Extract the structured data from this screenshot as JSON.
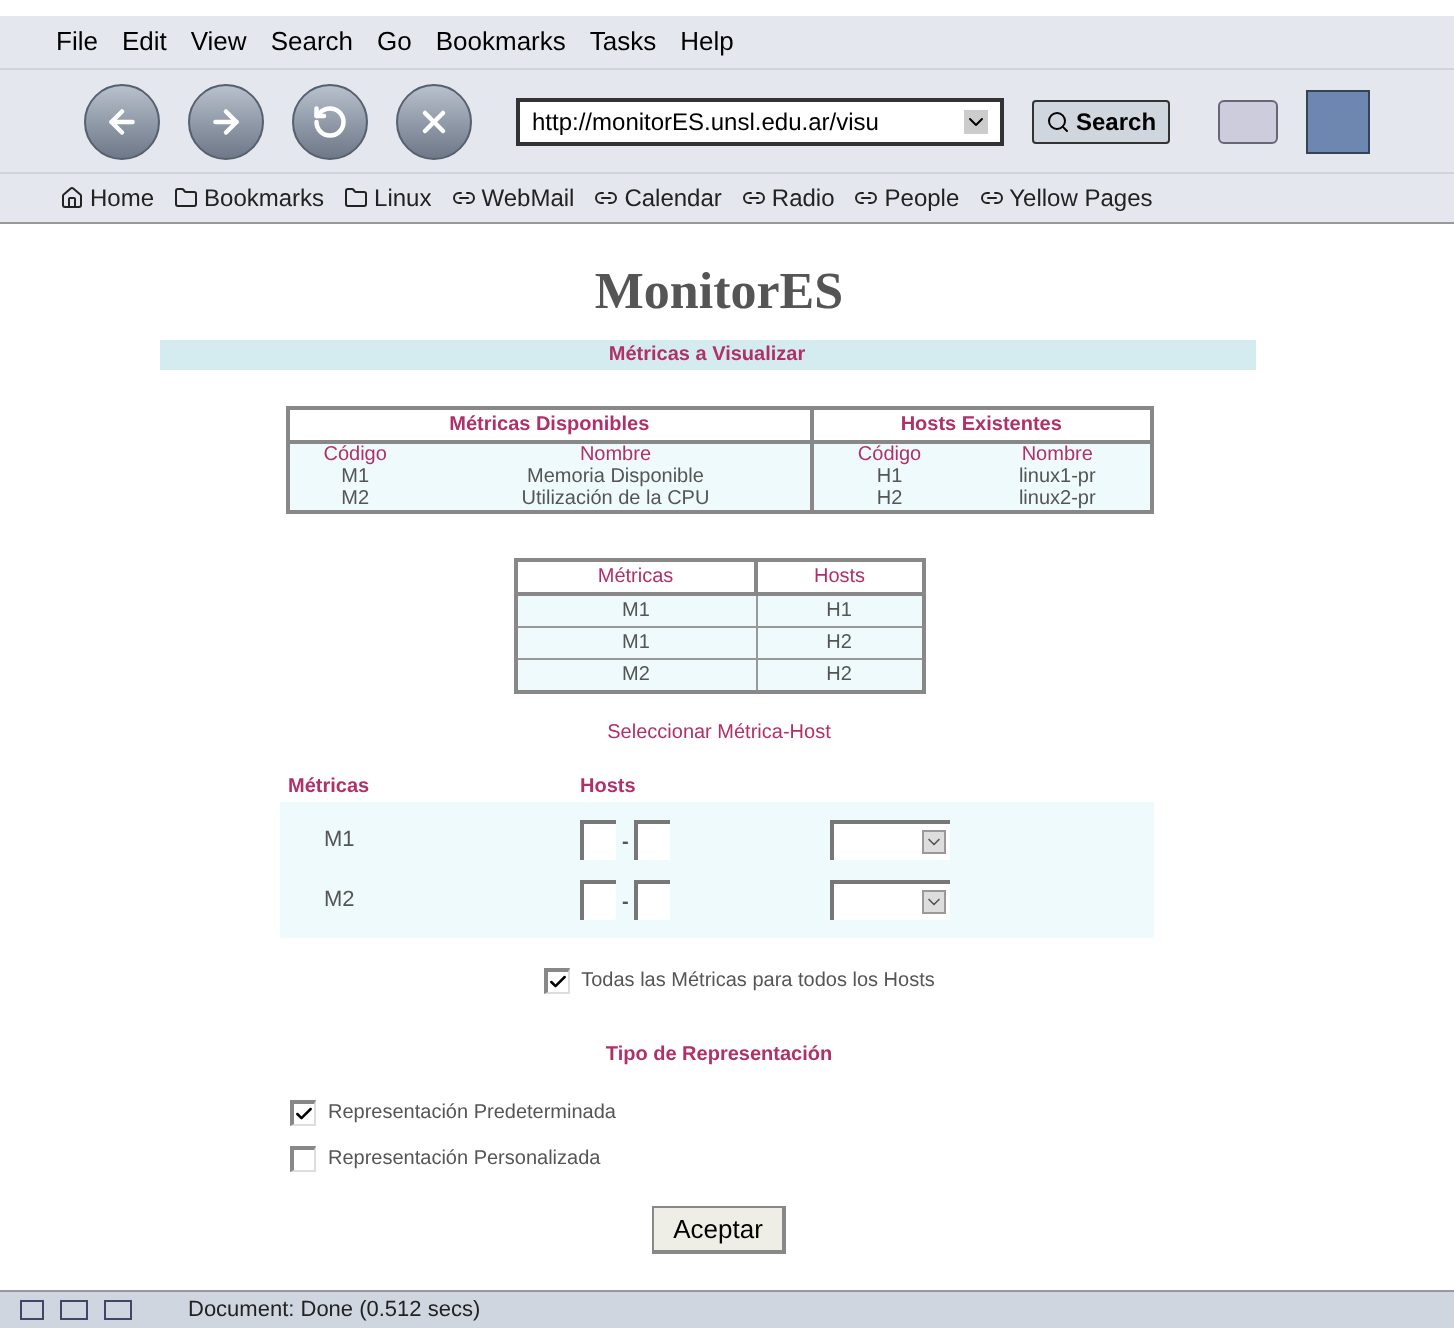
{
  "menu": [
    "File",
    "Edit",
    "View",
    "Search",
    "Go",
    "Bookmarks",
    "Tasks",
    "Help"
  ],
  "url_field": {
    "value": "http://monitorES.unsl.edu.ar/visu"
  },
  "search_button": "Search",
  "bookmarks": [
    {
      "label": "Home",
      "kind": "home"
    },
    {
      "label": "Bookmarks",
      "kind": "folder"
    },
    {
      "label": "Linux",
      "kind": "folder"
    },
    {
      "label": "WebMail",
      "kind": "link"
    },
    {
      "label": "Calendar",
      "kind": "link"
    },
    {
      "label": "Radio",
      "kind": "link"
    },
    {
      "label": "People",
      "kind": "link"
    },
    {
      "label": "Yellow Pages",
      "kind": "link"
    }
  ],
  "page": {
    "title": "MonitorES",
    "section_title": "Métricas a Visualizar",
    "available": {
      "metrics_heading": "Métricas Disponibles",
      "hosts_heading": "Hosts Existentes",
      "metric_columns": [
        "Código",
        "Nombre"
      ],
      "host_columns": [
        "Código",
        "Nombre"
      ],
      "metrics": [
        [
          "M1",
          "Memoria Disponible"
        ],
        [
          "M2",
          "Utilización de la CPU"
        ]
      ],
      "hosts": [
        [
          "H1",
          "linux1-pr"
        ],
        [
          "H2",
          "linux2-pr"
        ]
      ]
    },
    "pairs": {
      "columns": [
        "Métricas",
        "Hosts"
      ],
      "rows": [
        [
          "M1",
          "H1"
        ],
        [
          "M1",
          "H2"
        ],
        [
          "M2",
          "H2"
        ]
      ]
    },
    "select_title": "Seleccionar Métrica-Host",
    "select_columns": [
      "Métricas",
      "Hosts"
    ],
    "select_rows": [
      {
        "metric": "M1",
        "separator": "-"
      },
      {
        "metric": "M2",
        "separator": "-"
      }
    ],
    "all_checkbox": {
      "label": "Todas las Métricas para todos los Hosts",
      "checked": true
    },
    "type_title": "Tipo de Representación",
    "type_options": [
      {
        "label": "Representación Predeterminada",
        "checked": true
      },
      {
        "label": "Representación Personalizada",
        "checked": false
      }
    ],
    "submit": "Aceptar"
  },
  "status_bar": {
    "text": "Document: Done (0.512 secs)"
  }
}
